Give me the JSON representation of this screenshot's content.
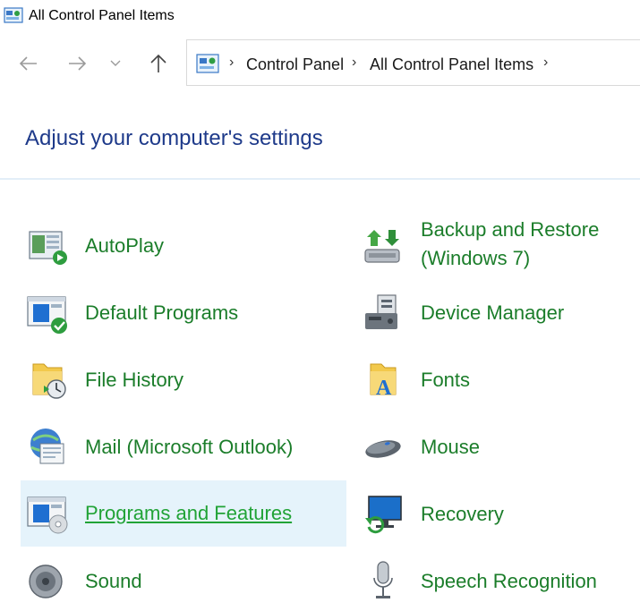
{
  "window": {
    "title": "All Control Panel Items"
  },
  "address": {
    "crumbs": [
      "Control Panel",
      "All Control Panel Items"
    ]
  },
  "page": {
    "heading": "Adjust your computer's settings"
  },
  "items": [
    {
      "label": "AutoPlay",
      "icon": "autoplay-icon"
    },
    {
      "label": "Backup and Restore",
      "label2": "(Windows 7)",
      "icon": "backup-restore-icon"
    },
    {
      "label": "Default Programs",
      "icon": "default-programs-icon"
    },
    {
      "label": "Device Manager",
      "icon": "device-manager-icon"
    },
    {
      "label": "File History",
      "icon": "file-history-icon"
    },
    {
      "label": "Fonts",
      "icon": "fonts-icon"
    },
    {
      "label": "Mail (Microsoft Outlook)",
      "icon": "mail-icon"
    },
    {
      "label": "Mouse",
      "icon": "mouse-icon"
    },
    {
      "label": "Programs and Features",
      "icon": "programs-features-icon",
      "selected": true
    },
    {
      "label": "Recovery",
      "icon": "recovery-icon"
    },
    {
      "label": "Sound",
      "icon": "sound-icon"
    },
    {
      "label": "Speech Recognition",
      "icon": "microphone-icon"
    }
  ],
  "colors": {
    "link": "#1b7d2a",
    "heading": "#1e3a8a",
    "selected_bg": "#e5f3fb"
  }
}
